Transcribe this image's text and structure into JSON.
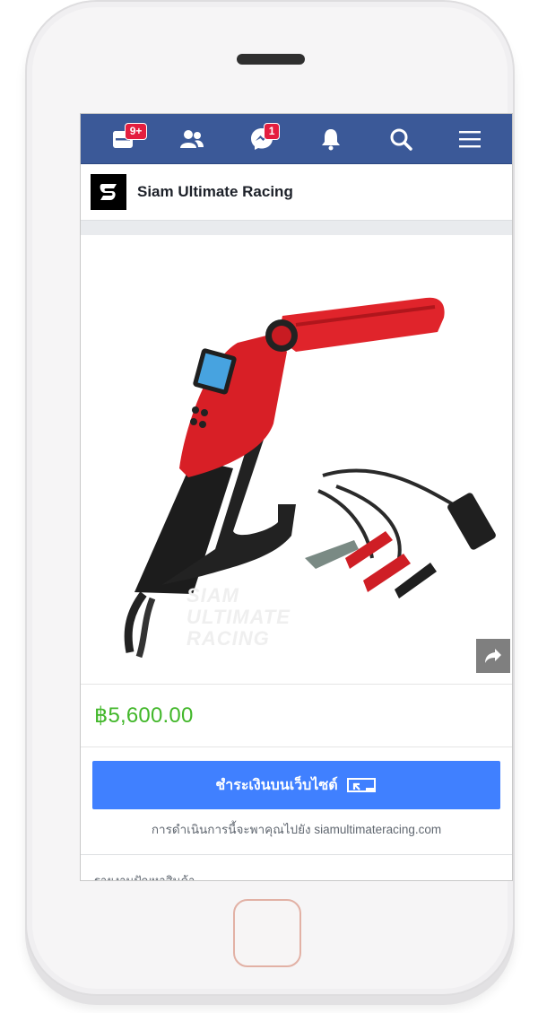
{
  "navbar": {
    "items": [
      {
        "name": "news-feed",
        "badge": "9+"
      },
      {
        "name": "friends",
        "badge": ""
      },
      {
        "name": "messenger",
        "badge": "1"
      },
      {
        "name": "notifications",
        "badge": ""
      },
      {
        "name": "search",
        "badge": ""
      },
      {
        "name": "menu",
        "badge": ""
      }
    ],
    "color": "#3b5998"
  },
  "page": {
    "name": "Siam Ultimate Racing"
  },
  "product": {
    "watermark": [
      "SIAM",
      "ULTIMATE",
      "RACING"
    ],
    "price": "฿5,600.00",
    "price_color": "#42b72a"
  },
  "checkout": {
    "button_label": "ชำระเงินบนเว็บไซต์",
    "button_color": "#4080ff",
    "redirect_note": "การดำเนินการนี้จะพาคุณไปยัง siamultimateracing.com"
  },
  "report": {
    "label": "รายงานปัญหาสินค้า"
  }
}
